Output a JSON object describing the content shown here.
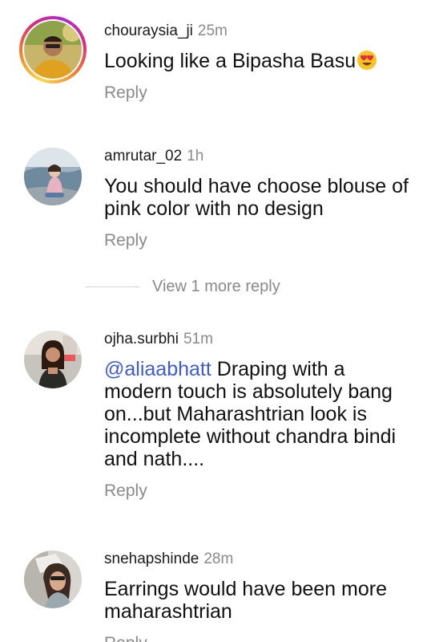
{
  "comments": [
    {
      "username": "chouraysia_ji",
      "time": "25m",
      "text": "Looking like a Bipasha Basu",
      "emoji": "smiling-face-with-heart-eyes",
      "reply_label": "Reply",
      "has_story_ring": true
    },
    {
      "username": "amrutar_02",
      "time": "1h",
      "text_lines": [
        "You should have choose blouse of",
        "pink color with no design"
      ],
      "reply_label": "Reply"
    },
    {
      "username": "ojha.surbhi",
      "time": "51m",
      "mention": "@aliaabhatt",
      "text_first_line_rest": " Draping with a",
      "text_lines": [
        "modern touch is absolutely bang",
        "on...but Maharashtrian look is",
        "incomplete without chandra bindi",
        "and nath...."
      ],
      "reply_label": "Reply"
    },
    {
      "username": "snehapshinde",
      "time": "28m",
      "text_lines": [
        "Earrings would have been more",
        "maharashtrian"
      ],
      "reply_label": "Reply"
    }
  ],
  "view_more_replies": "View 1 more reply",
  "colors": {
    "mention": "#3d5bd6",
    "muted": "#8a8a8a",
    "text": "#111111"
  }
}
